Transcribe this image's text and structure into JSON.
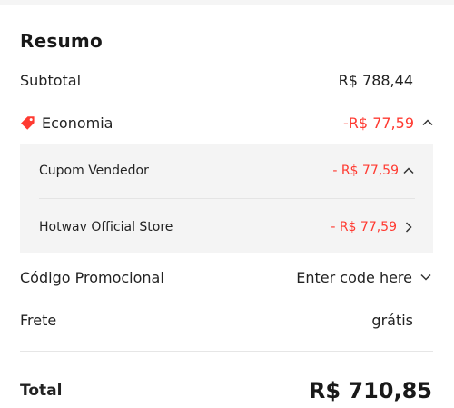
{
  "summary": {
    "title": "Resumo",
    "subtotal": {
      "label": "Subtotal",
      "value": "R$ 788,44"
    },
    "savings": {
      "label": "Economia",
      "value": "-R$ 77,59",
      "icon": "tag-icon",
      "expanded": true,
      "items": [
        {
          "label": "Cupom Vendedor",
          "value": "- R$ 77,59",
          "chevron": "chevron-up"
        },
        {
          "label": "Hotwav Official Store",
          "value": "- R$ 77,59",
          "chevron": "chevron-right"
        }
      ]
    },
    "promo": {
      "label": "Código Promocional",
      "value": "Enter code here",
      "chevron": "chevron-down"
    },
    "shipping": {
      "label": "Frete",
      "value": "grátis"
    },
    "total": {
      "label": "Total",
      "value": "R$ 710,85"
    }
  },
  "colors": {
    "accent": "#ff3a31",
    "panel": "#f4f4f4",
    "text": "#222222"
  }
}
